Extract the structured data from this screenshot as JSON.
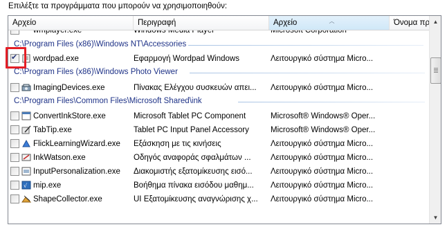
{
  "prompt": "Επιλέξτε τα προγράμματα που μπορούν να χρησιμοποιηθούν:",
  "columns": [
    {
      "label": "Αρχείο"
    },
    {
      "label": "Περιγραφή"
    },
    {
      "label": "Αρχείο"
    },
    {
      "label": "Όνομα πρ"
    }
  ],
  "rows": [
    {
      "file": "wmplayer.exe",
      "desc": "Windows Media Player",
      "company": "Microsoft Corporation",
      "partial": true
    },
    {
      "group": "C:\\Program Files (x86)\\Windows NT\\Accessories"
    },
    {
      "file": "wordpad.exe",
      "desc": "Εφαρμογή Wordpad Windows",
      "company": "Λειτουργικό σύστημα Micro...",
      "checked": true
    },
    {
      "group": "C:\\Program Files (x86)\\Windows Photo Viewer"
    },
    {
      "file": "ImagingDevices.exe",
      "desc": "Πίνακας Ελέγχου συσκευών απει...",
      "company": "Λειτουργικό σύστημα Micro..."
    },
    {
      "group": "C:\\Program Files\\Common Files\\Microsoft Shared\\ink"
    },
    {
      "file": "ConvertInkStore.exe",
      "desc": "Microsoft Tablet PC Component",
      "company": "Microsoft® Windows® Oper..."
    },
    {
      "file": "TabTip.exe",
      "desc": "Tablet PC Input Panel Accessory",
      "company": "Microsoft® Windows® Oper..."
    },
    {
      "file": "FlickLearningWizard.exe",
      "desc": "Εξάσκηση με τις κινήσεις",
      "company": "Λειτουργικό σύστημα Micro..."
    },
    {
      "file": "InkWatson.exe",
      "desc": "Οδηγός αναφοράς σφαλμάτων ...",
      "company": "Λειτουργικό σύστημα Micro..."
    },
    {
      "file": "InputPersonalization.exe",
      "desc": "Διακομιστής εξατομίκευσης εισό...",
      "company": "Λειτουργικό σύστημα Micro..."
    },
    {
      "file": "mip.exe",
      "desc": "Βοήθημα πίνακα εισόδου μαθημ...",
      "company": "Λειτουργικό σύστημα Micro..."
    },
    {
      "file": "ShapeCollector.exe",
      "desc": "UI Εξατομίκευσης αναγνώρισης χ...",
      "company": "Λειτουργικό σύστημα Micro..."
    }
  ],
  "icons": [
    "wordpad-icon",
    "imaging-icon",
    "app-window-icon",
    "tablet-pen-icon",
    "flick-icon",
    "ink-watson-icon",
    "input-icon",
    "mip-icon",
    "shape-icon"
  ],
  "colors": {
    "group_text": "#1e3287",
    "highlight": "#e41e26",
    "sort_column": "#d0e8f8"
  }
}
